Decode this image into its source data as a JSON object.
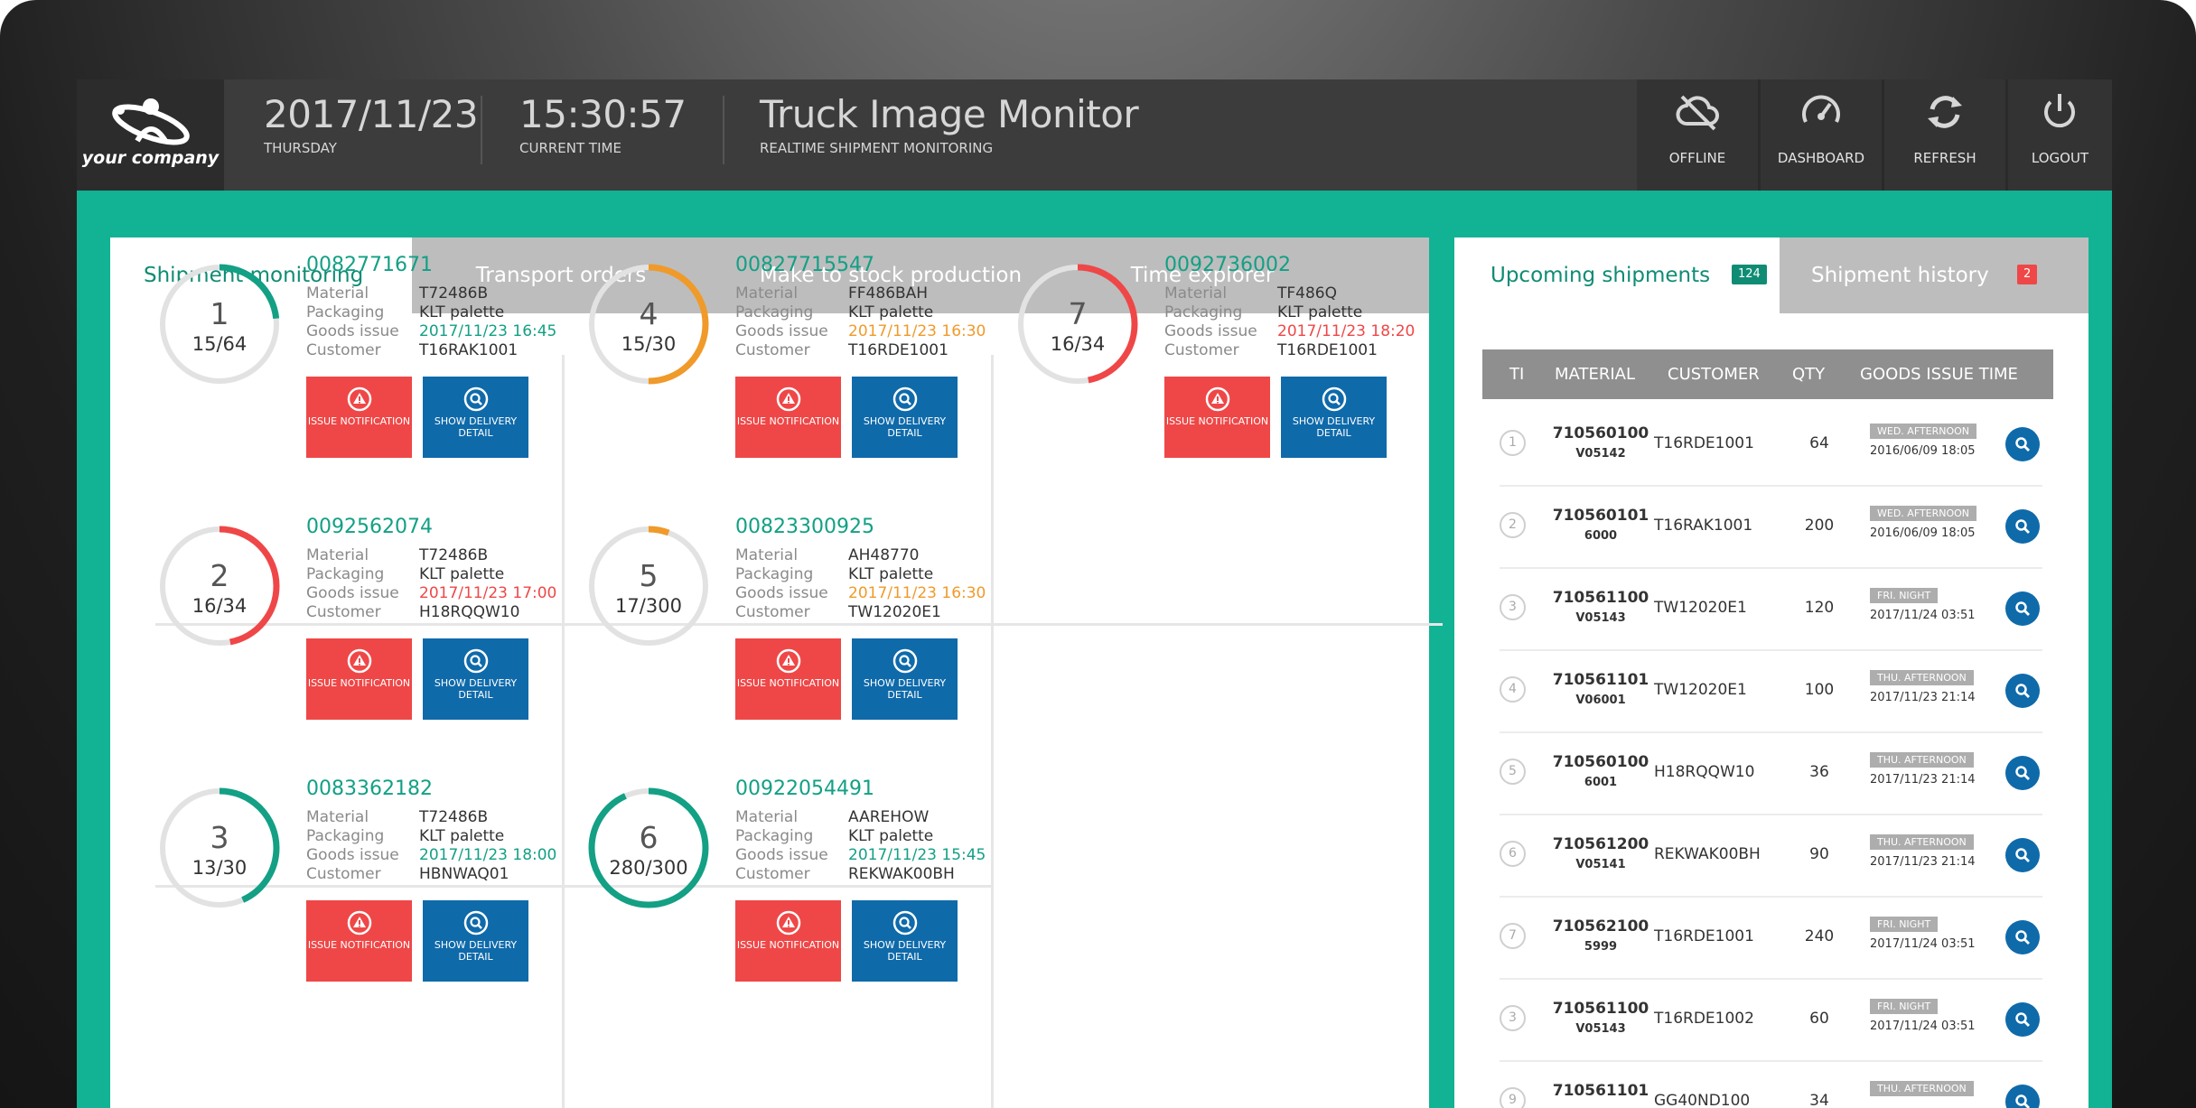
{
  "brand": {
    "company": "your company"
  },
  "header": {
    "date": "2017/11/23",
    "weekday": "THURSDAY",
    "time": "15:30:57",
    "time_label": "CURRENT TIME",
    "title": "Truck Image Monitor",
    "subtitle": "REALTIME SHIPMENT MONITORING",
    "buttons": [
      {
        "label": "OFFLINE",
        "icon": "cloud-offline-icon"
      },
      {
        "label": "DASHBOARD",
        "icon": "gauge-icon"
      },
      {
        "label": "REFRESH",
        "icon": "refresh-icon"
      },
      {
        "label": "LOGOUT",
        "icon": "power-icon"
      }
    ]
  },
  "colors": {
    "teal": "#12b295",
    "green": "#13a085",
    "orange": "#f09a2a",
    "red": "#ef4747",
    "blue": "#0f6aaa"
  },
  "tabs": [
    {
      "label": "Shipment monitoring",
      "active": true
    },
    {
      "label": "Transport orders",
      "active": false
    },
    {
      "label": "Make to stock production",
      "active": false
    },
    {
      "label": "Time explorer",
      "active": false
    }
  ],
  "field_labels": {
    "material": "Material",
    "packaging": "Packaging",
    "goods_issue": "Goods issue",
    "customer": "Customer"
  },
  "button_labels": {
    "issue": "ISSUE NOTIFICATION",
    "detail": "SHOW DELIVERY DETAIL"
  },
  "shipments": [
    {
      "num": "1",
      "progress": "15/64",
      "fraction": 0.234,
      "status": "green",
      "id": "0082771671",
      "material": "T72486B",
      "packaging": "KLT palette",
      "goods_issue": "2017/11/23 16:45",
      "customer": "T16RAK1001"
    },
    {
      "num": "4",
      "progress": "15/30",
      "fraction": 0.5,
      "status": "orange",
      "id": "00827715547",
      "material": "FF486BAH",
      "packaging": "KLT palette",
      "goods_issue": "2017/11/23 16:30",
      "customer": "T16RDE1001"
    },
    {
      "num": "7",
      "progress": "16/34",
      "fraction": 0.47,
      "status": "red",
      "id": "0092736002",
      "material": "TF486Q",
      "packaging": "KLT palette",
      "goods_issue": "2017/11/23 18:20",
      "customer": "T16RDE1001"
    },
    {
      "num": "2",
      "progress": "16/34",
      "fraction": 0.47,
      "status": "red",
      "id": "0092562074",
      "material": "T72486B",
      "packaging": "KLT palette",
      "goods_issue": "2017/11/23 17:00",
      "customer": "H18RQQW10"
    },
    {
      "num": "5",
      "progress": "17/300",
      "fraction": 0.057,
      "status": "orange",
      "id": "00823300925",
      "material": "AH48770",
      "packaging": "KLT palette",
      "goods_issue": "2017/11/23 16:30",
      "customer": "TW12020E1"
    },
    {
      "num": "3",
      "progress": "13/30",
      "fraction": 0.433,
      "status": "green",
      "id": "0083362182",
      "material": "T72486B",
      "packaging": "KLT palette",
      "goods_issue": "2017/11/23 18:00",
      "customer": "HBNWAQ01"
    },
    {
      "num": "6",
      "progress": "280/300",
      "fraction": 0.933,
      "status": "green",
      "id": "00922054491",
      "material": "AAREHOW",
      "packaging": "KLT palette",
      "goods_issue": "2017/11/23 15:45",
      "customer": "REKWAK00BH"
    }
  ],
  "right_tabs": [
    {
      "label": "Upcoming shipments",
      "badge": "124",
      "active": true
    },
    {
      "label": "Shipment history",
      "badge": "2",
      "active": false
    }
  ],
  "table": {
    "columns": [
      "TI",
      "MATERIAL",
      "CUSTOMER",
      "QTY",
      "GOODS ISSUE TIME"
    ],
    "rows": [
      {
        "ti": "1",
        "material": "710560100",
        "material_sub": "V05142",
        "customer": "T16RDE1001",
        "qty": "64",
        "tag": "WED. AFTERNOON",
        "time": "2016/06/09 18:05"
      },
      {
        "ti": "2",
        "material": "710560101",
        "material_sub": "6000",
        "customer": "T16RAK1001",
        "qty": "200",
        "tag": "WED. AFTERNOON",
        "time": "2016/06/09 18:05"
      },
      {
        "ti": "3",
        "material": "710561100",
        "material_sub": "V05143",
        "customer": "TW12020E1",
        "qty": "120",
        "tag": "FRI. NIGHT",
        "time": "2017/11/24 03:51"
      },
      {
        "ti": "4",
        "material": "710561101",
        "material_sub": "V06001",
        "customer": "TW12020E1",
        "qty": "100",
        "tag": "THU. AFTERNOON",
        "time": "2017/11/23 21:14"
      },
      {
        "ti": "5",
        "material": "710560100",
        "material_sub": "6001",
        "customer": "H18RQQW10",
        "qty": "36",
        "tag": "THU. AFTERNOON",
        "time": "2017/11/23 21:14"
      },
      {
        "ti": "6",
        "material": "710561200",
        "material_sub": "V05141",
        "customer": "REKWAK00BH",
        "qty": "90",
        "tag": "THU. AFTERNOON",
        "time": "2017/11/23 21:14"
      },
      {
        "ti": "7",
        "material": "710562100",
        "material_sub": "5999",
        "customer": "T16RDE1001",
        "qty": "240",
        "tag": "FRI. NIGHT",
        "time": "2017/11/24 03:51"
      },
      {
        "ti": "3",
        "material": "710561100",
        "material_sub": "V05143",
        "customer": "T16RDE1002",
        "qty": "60",
        "tag": "FRI. NIGHT",
        "time": "2017/11/24 03:51"
      },
      {
        "ti": "9",
        "material": "710561101",
        "material_sub": "",
        "customer": "GG40ND100",
        "qty": "34",
        "tag": "THU. AFTERNOON",
        "time": ""
      }
    ]
  }
}
